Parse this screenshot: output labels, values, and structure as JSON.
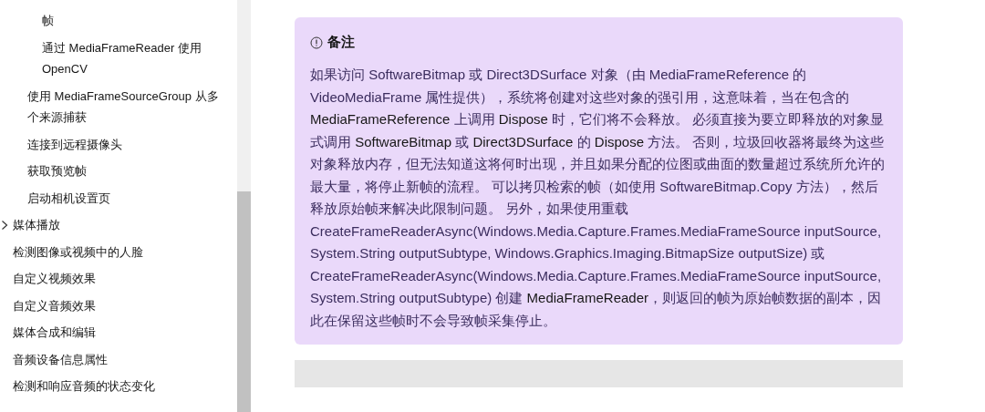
{
  "sidebar": {
    "items": [
      {
        "children": [
          {
            "children": [
              {
                "label": "帧"
              },
              {
                "label": "通过 MediaFrameReader 使用 OpenCV"
              }
            ]
          },
          {
            "label": "使用 MediaFrameSourceGroup 从多个来源捕获"
          },
          {
            "label": "连接到远程摄像头"
          },
          {
            "label": "获取预览帧"
          },
          {
            "label": "启动相机设置页"
          }
        ]
      },
      {
        "label": "媒体播放",
        "expanded": false
      },
      {
        "label": "检测图像或视频中的人脸"
      },
      {
        "label": "自定义视频效果"
      },
      {
        "label": "自定义音频效果"
      },
      {
        "label": "媒体合成和编辑"
      },
      {
        "label": "音频设备信息属性"
      },
      {
        "label": "检测和响应音频的状态变化"
      }
    ]
  },
  "note": {
    "title": "备注",
    "text": "如果访问 SoftwareBitmap 或 Direct3DSurface 对象（由 MediaFrameReference 的 VideoMediaFrame 属性提供），系统将创建对这些对象的强引用，这意味着，当在包含的 **MediaFrameReference** 上调用 **Dispose** 时，它们将不会释放。 必须直接为要立即释放的对象显式调用 **SoftwareBitmap** 或 **Direct3DSurface** 的 **Dispose** 方法。 否则，垃圾回收器将最终为这些对象释放内存，但无法知道这将何时出现，并且如果分配的位图或曲面的数量超过系统所允许的最大量，将停止新帧的流程。 可以拷贝检索的帧（如使用 SoftwareBitmap.Copy 方法），然后释放原始帧来解决此限制问题。 另外，如果使用重载 CreateFrameReaderAsync(Windows.Media.Capture.Frames.MediaFrameSource inputSource, System.String outputSubtype, Windows.Graphics.Imaging.BitmapSize outputSize) 或 CreateFrameReaderAsync(Windows.Media.Capture.Frames.MediaFrameSource inputSource, System.String outputSubtype) 创建 **MediaFrameReader**，则返回的帧为原始帧数据的副本，因此在保留这些帧时不会导致帧采集停止。"
  }
}
